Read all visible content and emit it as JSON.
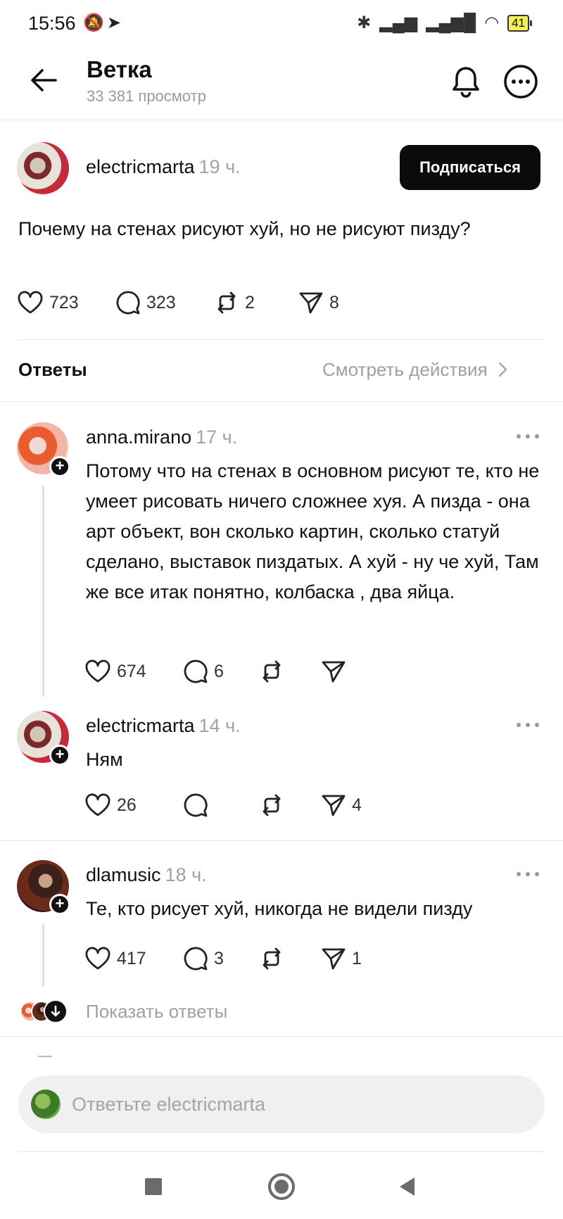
{
  "status_bar": {
    "time": "15:56",
    "battery": "41"
  },
  "header": {
    "title": "Ветка",
    "views": "33 381 просмотр"
  },
  "post": {
    "username": "electricmarta",
    "time": "19 ч.",
    "follow_label": "Подписаться",
    "text": "Почему на стенах рисуют хуй, но не рисуют пизду?",
    "likes": "723",
    "comments": "323",
    "reposts": "2",
    "shares": "8"
  },
  "section": {
    "replies_label": "Ответы",
    "activity_link": "Смотреть действия"
  },
  "replies": [
    {
      "username": "anna.mirano",
      "time": "17 ч.",
      "text": "Потому что на стенах в основном рисуют те, кто не умеет рисовать ничего сложнее хуя. А пизда - она арт объект, вон сколько картин, сколько статуй сделано, выставок пиздатых. А хуй - ну че хуй, Там же все итак понятно, колбаска , два яйца.",
      "likes": "674",
      "comments": "6",
      "reposts": "",
      "shares": ""
    },
    {
      "username": "electricmarta",
      "time": "14 ч.",
      "text": "Ням",
      "likes": "26",
      "comments": "",
      "reposts": "",
      "shares": "4"
    },
    {
      "username": "dlamusic",
      "time": "18 ч.",
      "text": "Те, кто рисует хуй, никогда не видели пизду",
      "likes": "417",
      "comments": "3",
      "reposts": "",
      "shares": "1"
    }
  ],
  "show_replies_label": "Показать ответы",
  "reply_bar": {
    "placeholder": "Ответьте electricmarta"
  },
  "icons": {
    "back": "arrow-left-icon",
    "bell": "bell-icon",
    "more": "more-icon",
    "like": "heart-icon",
    "comment": "comment-icon",
    "repost": "repost-icon",
    "share": "send-icon"
  }
}
